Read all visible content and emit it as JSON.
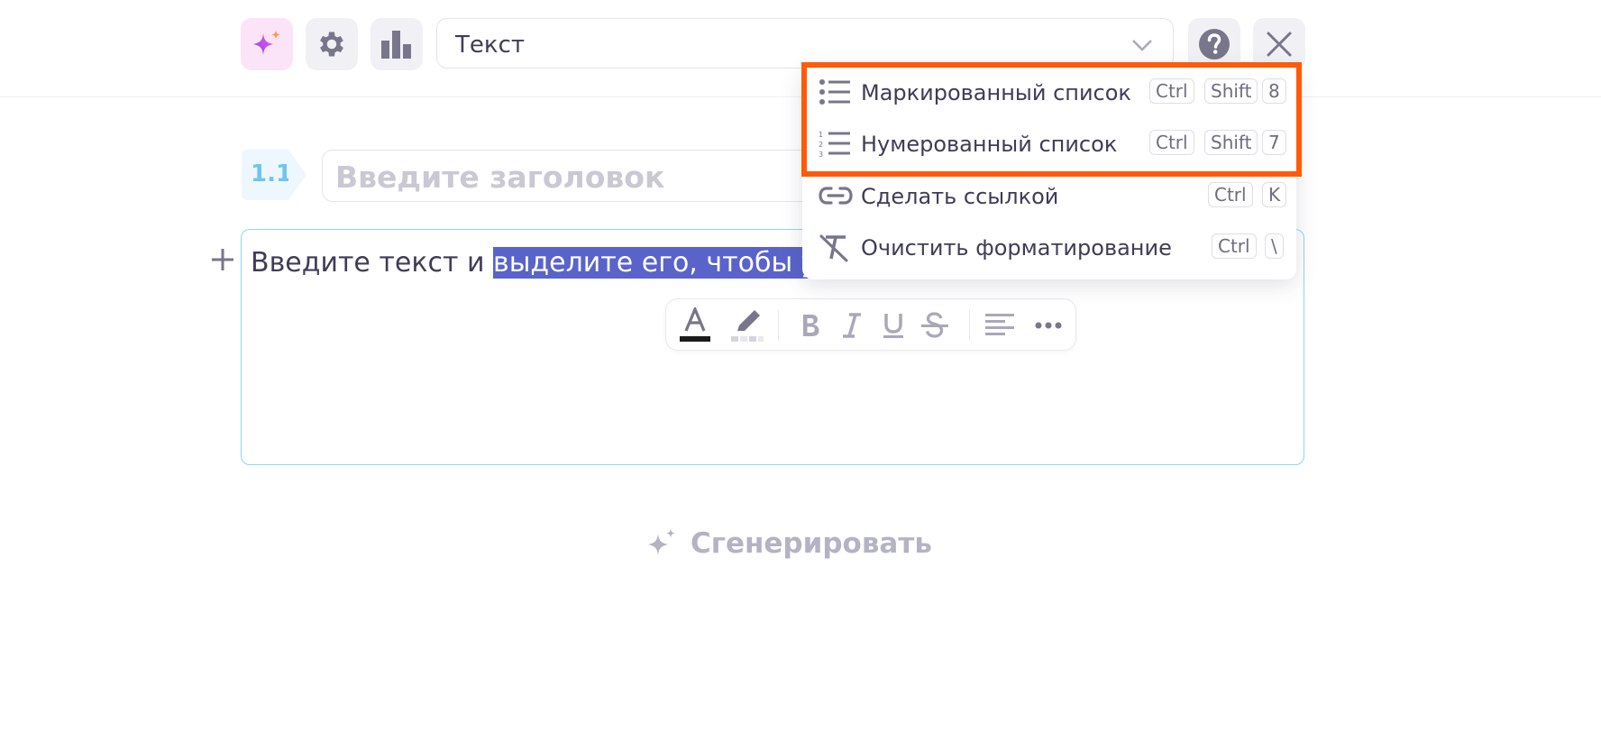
{
  "toolbar": {
    "block_type_value": "Текст"
  },
  "heading": {
    "number": "1.1",
    "placeholder": "Введите заголовок"
  },
  "editor": {
    "text_plain": "Введите текст и ",
    "text_selected": "выделите его, чтобы ув"
  },
  "dropdown_menu": {
    "items": [
      {
        "label": "Маркированный список",
        "icon": "bullet-list-icon",
        "shortcut": [
          "Ctrl",
          "Shift",
          "8"
        ]
      },
      {
        "label": "Нумерованный список",
        "icon": "numbered-list-icon",
        "shortcut": [
          "Ctrl",
          "Shift",
          "7"
        ]
      },
      {
        "label": "Сделать ссылкой",
        "icon": "link-icon",
        "shortcut": [
          "Ctrl",
          "K"
        ]
      },
      {
        "label": "Очистить форматирование",
        "icon": "clear-format-icon",
        "shortcut": [
          "Ctrl",
          "\\"
        ]
      }
    ]
  },
  "generate_button": {
    "label": "Сгенерировать"
  },
  "colors": {
    "accent": "#5963c9",
    "highlight": "#ff5a0a",
    "border_active": "#8fd6ee",
    "number_badge": "#6ec6ef"
  }
}
